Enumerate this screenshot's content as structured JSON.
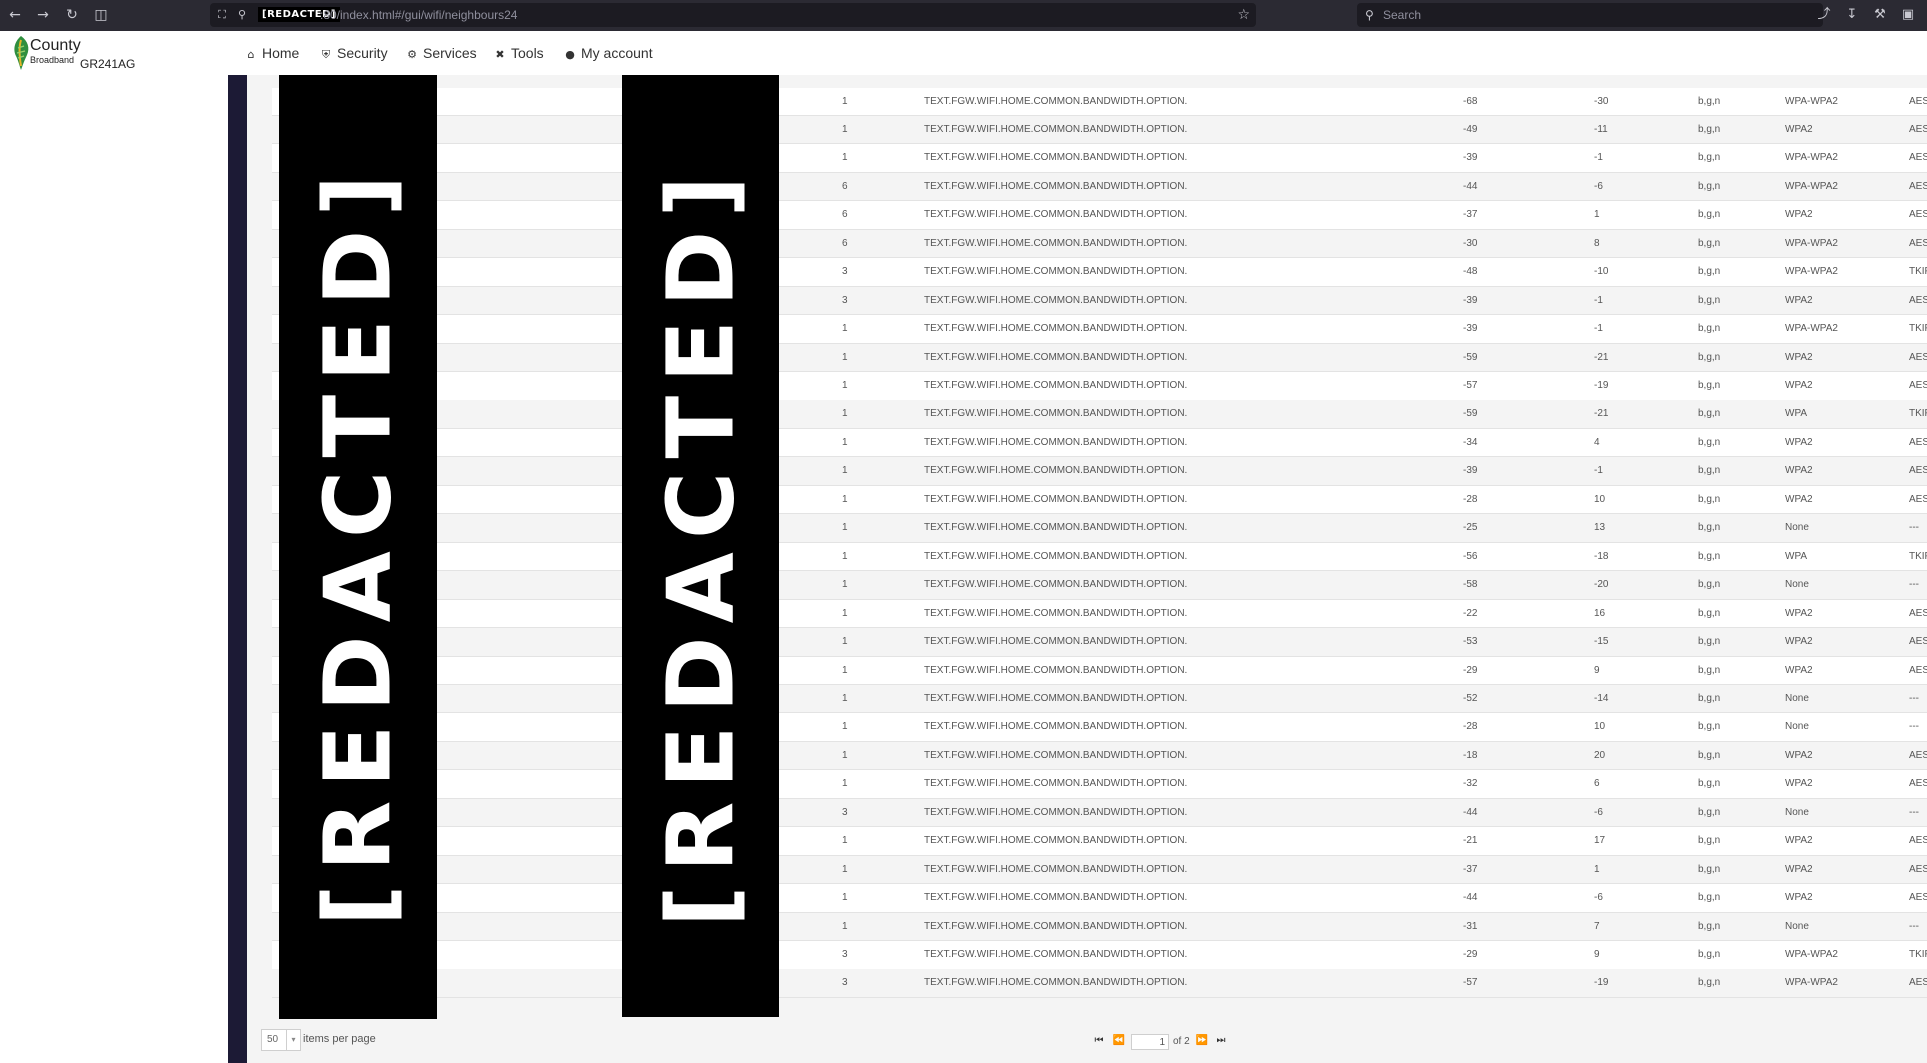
{
  "browser": {
    "url_redacted": "[REDACTED]",
    "url_suffix": ":80/index.html#/gui/wifi/neighbours24",
    "search_placeholder": "Search"
  },
  "brand": {
    "name_line1": "County",
    "name_line2": "Broadband",
    "model": "GR241AG"
  },
  "menu": [
    {
      "label": "Home",
      "icon": "home-icon"
    },
    {
      "label": "Security",
      "icon": "shield-icon"
    },
    {
      "label": "Services",
      "icon": "gears-icon"
    },
    {
      "label": "Tools",
      "icon": "wrench-icon"
    },
    {
      "label": "My account",
      "icon": "user-icon"
    }
  ],
  "redaction_label": "[REDACTED]",
  "table": {
    "rows": [
      {
        "channel": "1",
        "bandwidth": "TEXT.FGW.WIFI.HOME.COMMON.BANDWIDTH.OPTION.",
        "rssi": "-68",
        "snr": "-30",
        "mode": "b,g,n",
        "security": "WPA-WPA2",
        "encryption": "AES"
      },
      {
        "channel": "1",
        "bandwidth": "TEXT.FGW.WIFI.HOME.COMMON.BANDWIDTH.OPTION.",
        "rssi": "-49",
        "snr": "-11",
        "mode": "b,g,n",
        "security": "WPA2",
        "encryption": "AES"
      },
      {
        "channel": "1",
        "bandwidth": "TEXT.FGW.WIFI.HOME.COMMON.BANDWIDTH.OPTION.",
        "rssi": "-39",
        "snr": "-1",
        "mode": "b,g,n",
        "security": "WPA-WPA2",
        "encryption": "AES"
      },
      {
        "channel": "6",
        "bandwidth": "TEXT.FGW.WIFI.HOME.COMMON.BANDWIDTH.OPTION.",
        "rssi": "-44",
        "snr": "-6",
        "mode": "b,g,n",
        "security": "WPA-WPA2",
        "encryption": "AES"
      },
      {
        "channel": "6",
        "bandwidth": "TEXT.FGW.WIFI.HOME.COMMON.BANDWIDTH.OPTION.",
        "rssi": "-37",
        "snr": "1",
        "mode": "b,g,n",
        "security": "WPA2",
        "encryption": "AES"
      },
      {
        "channel": "6",
        "bandwidth": "TEXT.FGW.WIFI.HOME.COMMON.BANDWIDTH.OPTION.",
        "rssi": "-30",
        "snr": "8",
        "mode": "b,g,n",
        "security": "WPA-WPA2",
        "encryption": "AES"
      },
      {
        "channel": "3",
        "bandwidth": "TEXT.FGW.WIFI.HOME.COMMON.BANDWIDTH.OPTION.",
        "rssi": "-48",
        "snr": "-10",
        "mode": "b,g,n",
        "security": "WPA-WPA2",
        "encryption": "TKIP,AES"
      },
      {
        "channel": "3",
        "bandwidth": "TEXT.FGW.WIFI.HOME.COMMON.BANDWIDTH.OPTION.",
        "rssi": "-39",
        "snr": "-1",
        "mode": "b,g,n",
        "security": "WPA2",
        "encryption": "AES"
      },
      {
        "channel": "1",
        "bandwidth": "TEXT.FGW.WIFI.HOME.COMMON.BANDWIDTH.OPTION.",
        "rssi": "-39",
        "snr": "-1",
        "mode": "b,g,n",
        "security": "WPA-WPA2",
        "encryption": "TKIP,AES"
      },
      {
        "channel": "1",
        "bandwidth": "TEXT.FGW.WIFI.HOME.COMMON.BANDWIDTH.OPTION.",
        "rssi": "-59",
        "snr": "-21",
        "mode": "b,g,n",
        "security": "WPA2",
        "encryption": "AES"
      },
      {
        "channel": "1",
        "bandwidth": "TEXT.FGW.WIFI.HOME.COMMON.BANDWIDTH.OPTION.",
        "rssi": "-57",
        "snr": "-19",
        "mode": "b,g,n",
        "security": "WPA2",
        "encryption": "AES"
      },
      {
        "channel": "1",
        "bandwidth": "TEXT.FGW.WIFI.HOME.COMMON.BANDWIDTH.OPTION.",
        "rssi": "-59",
        "snr": "-21",
        "mode": "b,g,n",
        "security": "WPA",
        "encryption": "TKIP,AES"
      },
      {
        "channel": "1",
        "bandwidth": "TEXT.FGW.WIFI.HOME.COMMON.BANDWIDTH.OPTION.",
        "rssi": "-34",
        "snr": "4",
        "mode": "b,g,n",
        "security": "WPA2",
        "encryption": "AES"
      },
      {
        "channel": "1",
        "bandwidth": "TEXT.FGW.WIFI.HOME.COMMON.BANDWIDTH.OPTION.",
        "rssi": "-39",
        "snr": "-1",
        "mode": "b,g,n",
        "security": "WPA2",
        "encryption": "AES"
      },
      {
        "channel": "1",
        "bandwidth": "TEXT.FGW.WIFI.HOME.COMMON.BANDWIDTH.OPTION.",
        "rssi": "-28",
        "snr": "10",
        "mode": "b,g,n",
        "security": "WPA2",
        "encryption": "AES"
      },
      {
        "channel": "1",
        "bandwidth": "TEXT.FGW.WIFI.HOME.COMMON.BANDWIDTH.OPTION.",
        "rssi": "-25",
        "snr": "13",
        "mode": "b,g,n",
        "security": "None",
        "encryption": "---"
      },
      {
        "channel": "1",
        "bandwidth": "TEXT.FGW.WIFI.HOME.COMMON.BANDWIDTH.OPTION.",
        "rssi": "-56",
        "snr": "-18",
        "mode": "b,g,n",
        "security": "WPA",
        "encryption": "TKIP,AES"
      },
      {
        "channel": "1",
        "bandwidth": "TEXT.FGW.WIFI.HOME.COMMON.BANDWIDTH.OPTION.",
        "rssi": "-58",
        "snr": "-20",
        "mode": "b,g,n",
        "security": "None",
        "encryption": "---"
      },
      {
        "channel": "1",
        "bandwidth": "TEXT.FGW.WIFI.HOME.COMMON.BANDWIDTH.OPTION.",
        "rssi": "-22",
        "snr": "16",
        "mode": "b,g,n",
        "security": "WPA2",
        "encryption": "AES"
      },
      {
        "channel": "1",
        "bandwidth": "TEXT.FGW.WIFI.HOME.COMMON.BANDWIDTH.OPTION.",
        "rssi": "-53",
        "snr": "-15",
        "mode": "b,g,n",
        "security": "WPA2",
        "encryption": "AES"
      },
      {
        "channel": "1",
        "bandwidth": "TEXT.FGW.WIFI.HOME.COMMON.BANDWIDTH.OPTION.",
        "rssi": "-29",
        "snr": "9",
        "mode": "b,g,n",
        "security": "WPA2",
        "encryption": "AES"
      },
      {
        "channel": "1",
        "bandwidth": "TEXT.FGW.WIFI.HOME.COMMON.BANDWIDTH.OPTION.",
        "rssi": "-52",
        "snr": "-14",
        "mode": "b,g,n",
        "security": "None",
        "encryption": "---"
      },
      {
        "channel": "1",
        "bandwidth": "TEXT.FGW.WIFI.HOME.COMMON.BANDWIDTH.OPTION.",
        "rssi": "-28",
        "snr": "10",
        "mode": "b,g,n",
        "security": "None",
        "encryption": "---"
      },
      {
        "channel": "1",
        "bandwidth": "TEXT.FGW.WIFI.HOME.COMMON.BANDWIDTH.OPTION.",
        "rssi": "-18",
        "snr": "20",
        "mode": "b,g,n",
        "security": "WPA2",
        "encryption": "AES"
      },
      {
        "channel": "1",
        "bandwidth": "TEXT.FGW.WIFI.HOME.COMMON.BANDWIDTH.OPTION.",
        "rssi": "-32",
        "snr": "6",
        "mode": "b,g,n",
        "security": "WPA2",
        "encryption": "AES"
      },
      {
        "channel": "3",
        "bandwidth": "TEXT.FGW.WIFI.HOME.COMMON.BANDWIDTH.OPTION.",
        "rssi": "-44",
        "snr": "-6",
        "mode": "b,g,n",
        "security": "None",
        "encryption": "---"
      },
      {
        "channel": "1",
        "bandwidth": "TEXT.FGW.WIFI.HOME.COMMON.BANDWIDTH.OPTION.",
        "rssi": "-21",
        "snr": "17",
        "mode": "b,g,n",
        "security": "WPA2",
        "encryption": "AES"
      },
      {
        "channel": "1",
        "bandwidth": "TEXT.FGW.WIFI.HOME.COMMON.BANDWIDTH.OPTION.",
        "rssi": "-37",
        "snr": "1",
        "mode": "b,g,n",
        "security": "WPA2",
        "encryption": "AES"
      },
      {
        "channel": "1",
        "bandwidth": "TEXT.FGW.WIFI.HOME.COMMON.BANDWIDTH.OPTION.",
        "rssi": "-44",
        "snr": "-6",
        "mode": "b,g,n",
        "security": "WPA2",
        "encryption": "AES"
      },
      {
        "channel": "1",
        "bandwidth": "TEXT.FGW.WIFI.HOME.COMMON.BANDWIDTH.OPTION.",
        "rssi": "-31",
        "snr": "7",
        "mode": "b,g,n",
        "security": "None",
        "encryption": "---"
      },
      {
        "channel": "3",
        "bandwidth": "TEXT.FGW.WIFI.HOME.COMMON.BANDWIDTH.OPTION.",
        "rssi": "-29",
        "snr": "9",
        "mode": "b,g,n",
        "security": "WPA-WPA2",
        "encryption": "TKIP,AES"
      },
      {
        "channel": "3",
        "bandwidth": "TEXT.FGW.WIFI.HOME.COMMON.BANDWIDTH.OPTION.",
        "rssi": "-57",
        "snr": "-19",
        "mode": "b,g,n",
        "security": "WPA-WPA2",
        "encryption": "AES"
      }
    ]
  },
  "pagination": {
    "items_per_page": "50",
    "items_per_page_label": "items per page",
    "current_page": "1",
    "of_label": "of 2"
  }
}
